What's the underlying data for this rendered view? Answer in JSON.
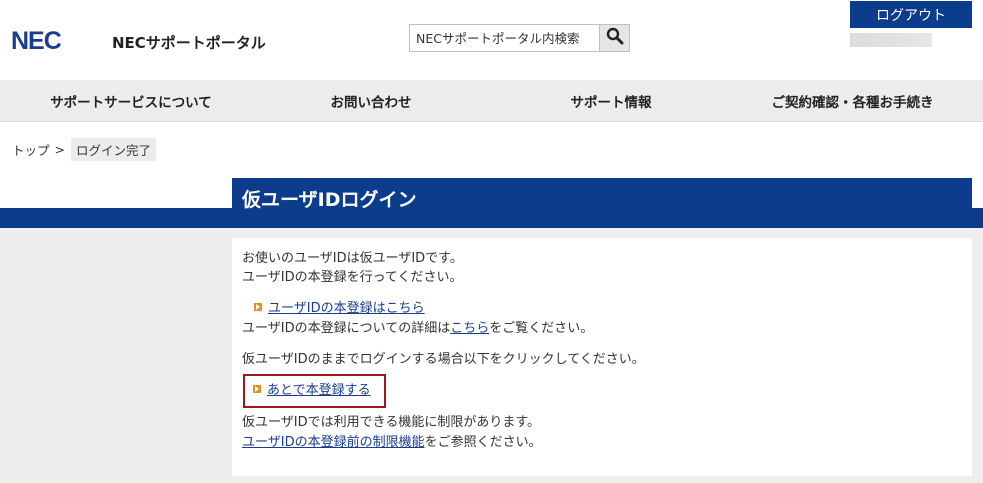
{
  "header": {
    "logo": "NEC",
    "portal_title": "NECサポートポータル",
    "search_placeholder": "NECサポートポータル内検索",
    "search_icon": "search-icon",
    "logout_label": "ログアウト"
  },
  "nav": {
    "items": [
      {
        "label": "サポートサービスについて"
      },
      {
        "label": "お問い合わせ"
      },
      {
        "label": "サポート情報"
      },
      {
        "label": "ご契約確認・各種お手続き"
      }
    ]
  },
  "breadcrumb": {
    "top": "トップ",
    "separator": ">",
    "current": "ログイン完了"
  },
  "page": {
    "title": "仮ユーザIDログイン",
    "intro_line1": "お使いのユーザIDは仮ユーザIDです。",
    "intro_line2": "ユーザIDの本登録を行ってください。",
    "register_link": "ユーザIDの本登録はこちら",
    "detail_prefix": "ユーザIDの本登録についての詳細は",
    "detail_link": "こちら",
    "detail_suffix": "をご覧ください。",
    "later_instruction": "仮ユーザIDのままでログインする場合以下をクリックしてください。",
    "later_link": "あとで本登録する",
    "limit_line": "仮ユーザIDでは利用できる機能に制限があります。",
    "limit_link": "ユーザIDの本登録前の制限機能",
    "limit_suffix": "をご参照ください。"
  },
  "colors": {
    "brand": "#0c3c8c",
    "link": "#1a3d8f",
    "arrow": "#e2901c",
    "highlight_border": "#a31717"
  }
}
